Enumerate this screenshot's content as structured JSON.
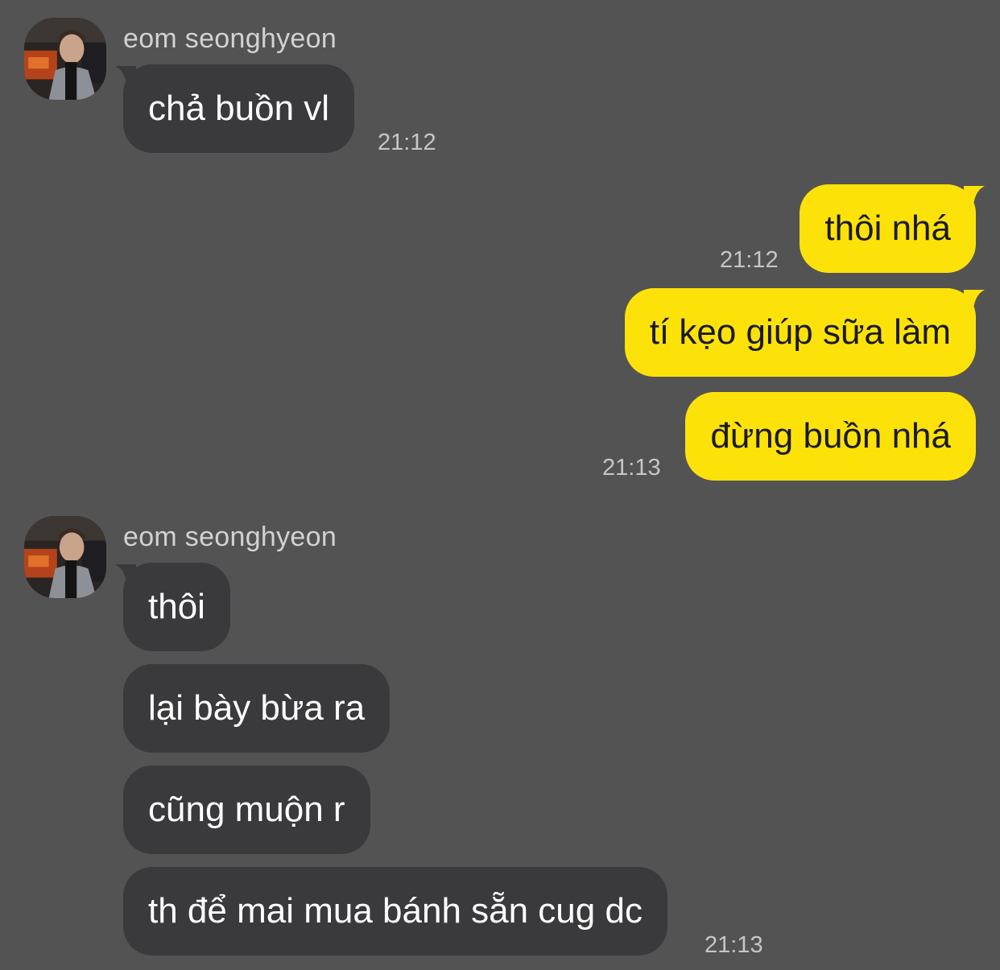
{
  "theme": {
    "background": "#545354",
    "incoming_bubble": "#3a393b",
    "outgoing_bubble": "#fde20a",
    "incoming_text": "#ffffff",
    "outgoing_text": "#1a1a1a"
  },
  "groups": [
    {
      "direction": "incoming",
      "sender": "eom seonghyeon",
      "messages": [
        {
          "text": "chả buồn vl"
        }
      ],
      "time": "21:12"
    },
    {
      "direction": "outgoing",
      "messages": [
        {
          "text": "thôi nhá"
        }
      ],
      "time": "21:12"
    },
    {
      "direction": "outgoing",
      "messages": [
        {
          "text": "tí kẹo giúp sữa làm"
        },
        {
          "text": "đừng buồn nhá"
        }
      ],
      "time": "21:13"
    },
    {
      "direction": "incoming",
      "sender": "eom seonghyeon",
      "messages": [
        {
          "text": "thôi"
        },
        {
          "text": "lại bày bừa ra"
        },
        {
          "text": "cũng muộn r"
        },
        {
          "text": "th để mai mua bánh sẵn cug dc"
        }
      ],
      "time": "21:13"
    }
  ]
}
